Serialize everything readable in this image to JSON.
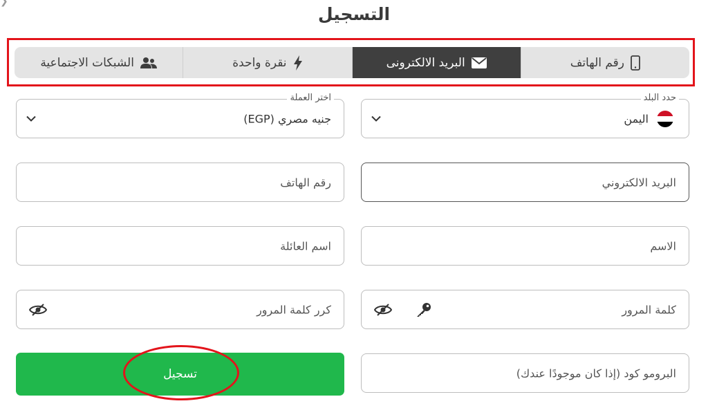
{
  "title": "التسجيل",
  "tabs": [
    {
      "label": "رقم الهاتف",
      "icon": "mobile-phone-icon",
      "active": false
    },
    {
      "label": "البريد الالكترونى",
      "icon": "envelope-icon",
      "active": true
    },
    {
      "label": "نقرة واحدة",
      "icon": "lightning-bolt-icon",
      "active": false
    },
    {
      "label": "الشبكات الاجتماعية",
      "icon": "users-icon",
      "active": false
    }
  ],
  "country": {
    "legend": "حدد البلد",
    "value": "اليمن",
    "icon": "yemen-flag-icon"
  },
  "currency": {
    "legend": "اختر العملة",
    "value": "جنيه مصري (EGP)"
  },
  "email": {
    "placeholder": "البريد الالكتروني"
  },
  "phone": {
    "placeholder": "رقم الهاتف"
  },
  "first_name": {
    "placeholder": "الاسم"
  },
  "last_name": {
    "placeholder": "اسم العائلة"
  },
  "password": {
    "placeholder": "كلمة المرور"
  },
  "password_confirm": {
    "placeholder": "كرر كلمة المرور"
  },
  "promo": {
    "placeholder": "البرومو كود (إذا كان موجودًا عندك)"
  },
  "submit": {
    "label": "تسجيل"
  },
  "colors": {
    "accent_green": "#20b84c",
    "active_tab": "#3f3f3f",
    "annotation_red": "#e3141b"
  }
}
